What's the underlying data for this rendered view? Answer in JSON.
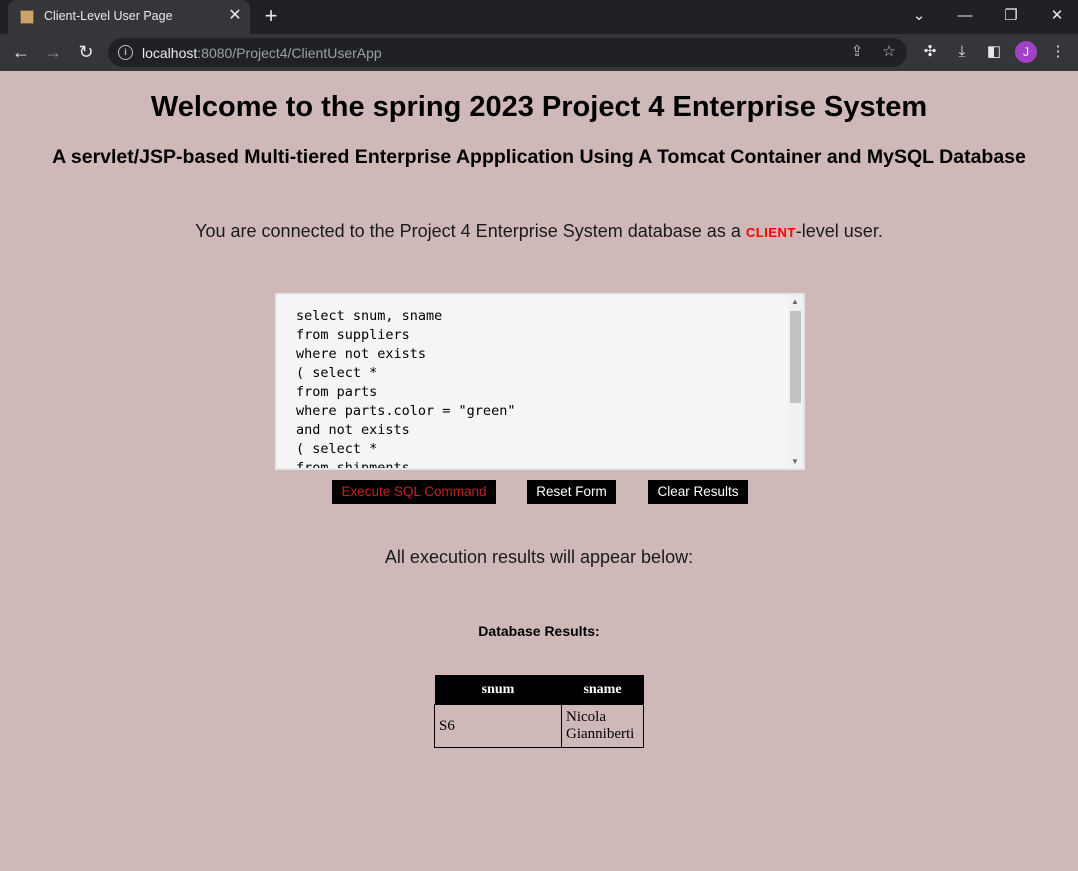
{
  "browser": {
    "tab_title": "Client-Level User Page",
    "url_host": "localhost",
    "url_rest": ":8080/Project4/ClientUserApp",
    "avatar_letter": "J",
    "avatar_color": "#a142c6"
  },
  "page": {
    "title": "Welcome to the spring 2023 Project 4 Enterprise System",
    "subtitle": "A servlet/JSP-based Multi-tiered Enterprise Appplication Using A Tomcat Container and MySQL Database",
    "connected_prefix": "You are connected to the Project 4 Enterprise System database as a ",
    "connected_role": "CLIENT",
    "connected_suffix": "-level user.",
    "role_color": "#ff0000",
    "background_color": "#cfb9b8"
  },
  "sql": {
    "query": "select snum, sname\nfrom suppliers\nwhere not exists\n( select *\nfrom parts\nwhere parts.color = \"green\"\nand not exists\n( select *\nfrom shipments"
  },
  "buttons": {
    "execute": "Execute SQL Command",
    "reset": "Reset Form",
    "clear": "Clear Results"
  },
  "results": {
    "note": "All execution results will appear below:",
    "heading": "Database Results:",
    "columns": [
      "snum",
      "sname"
    ],
    "rows": [
      [
        "S6",
        "Nicola Gianniberti"
      ]
    ]
  }
}
